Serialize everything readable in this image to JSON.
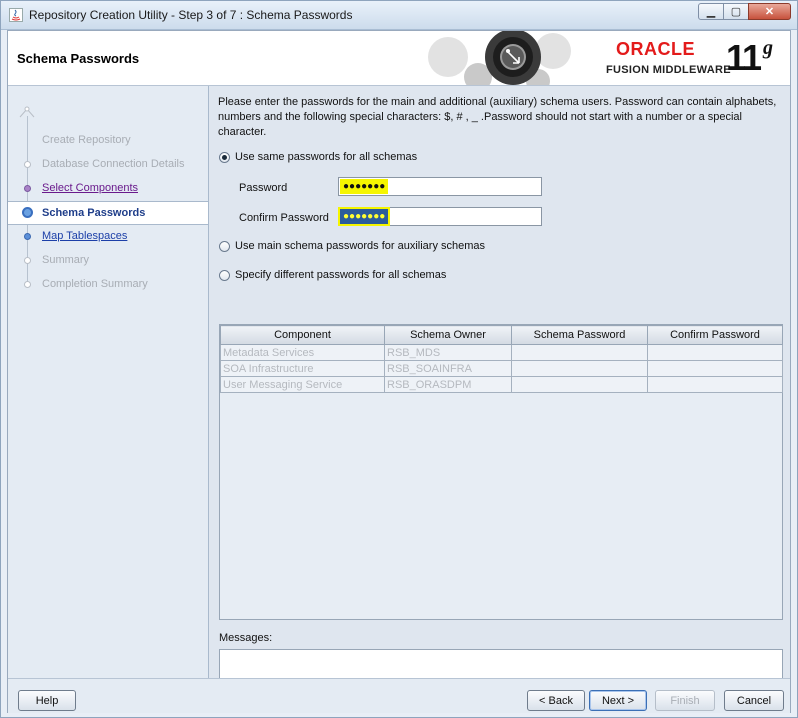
{
  "window": {
    "title": "Repository Creation Utility - Step 3 of 7 : Schema Passwords"
  },
  "header": {
    "page_title": "Schema Passwords",
    "brand": "ORACLE",
    "product": "FUSION MIDDLEWARE",
    "version": "11",
    "version_suffix": "g"
  },
  "steps": [
    {
      "label": "Create Repository",
      "state": "disabled"
    },
    {
      "label": "Database Connection Details",
      "state": "disabled"
    },
    {
      "label": "Select Components",
      "state": "done"
    },
    {
      "label": "Schema Passwords",
      "state": "current"
    },
    {
      "label": "Map Tablespaces",
      "state": "next"
    },
    {
      "label": "Summary",
      "state": "disabled"
    },
    {
      "label": "Completion Summary",
      "state": "disabled"
    }
  ],
  "main": {
    "intro": "Please enter the passwords for the main and additional (auxiliary) schema users. Password can contain alphabets, numbers and the following special characters: $, # , _ .Password should not start with a number or a special character.",
    "options": [
      {
        "label": "Use same passwords for all schemas",
        "checked": true
      },
      {
        "label": "Use main schema passwords for auxiliary schemas",
        "checked": false
      },
      {
        "label": "Specify different passwords for all schemas",
        "checked": false
      }
    ],
    "password_label": "Password",
    "password_value": "●●●●●●●",
    "confirm_label": "Confirm Password",
    "confirm_value": "●●●●●●●",
    "table": {
      "columns": [
        "Component",
        "Schema Owner",
        "Schema Password",
        "Confirm Password"
      ],
      "rows": [
        [
          "Metadata Services",
          "RSB_MDS",
          "",
          ""
        ],
        [
          "SOA Infrastructure",
          "RSB_SOAINFRA",
          "",
          ""
        ],
        [
          "User Messaging Service",
          "RSB_ORASDPM",
          "",
          ""
        ]
      ]
    },
    "messages_label": "Messages:"
  },
  "footer": {
    "help": "Help",
    "back": "< Back",
    "next": "Next >",
    "finish": "Finish",
    "cancel": "Cancel"
  }
}
